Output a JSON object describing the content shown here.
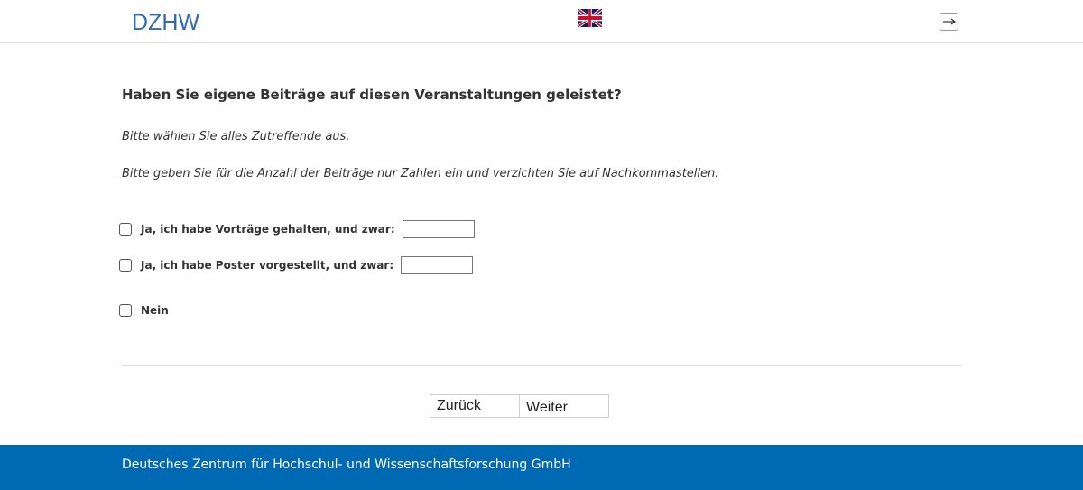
{
  "header": {
    "logo": "DZHW",
    "language_icon": "uk-flag-icon",
    "logout_icon": "logout-icon"
  },
  "question": {
    "title": "Haben Sie eigene Beiträge auf diesen Veranstaltungen geleistet?",
    "instruction_1": "Bitte wählen Sie alles Zutreffende aus.",
    "instruction_2": "Bitte geben Sie für die Anzahl der Beiträge nur Zahlen ein und verzichten Sie auf Nachkommastellen."
  },
  "options": [
    {
      "label": "Ja, ich habe Vorträge gehalten, und zwar:",
      "checked": false,
      "value": ""
    },
    {
      "label": "Ja, ich habe Poster vorgestellt, und zwar:",
      "checked": false,
      "value": ""
    },
    {
      "label": "Nein",
      "checked": false
    }
  ],
  "navigation": {
    "back_label": "Zurück",
    "next_label": "Weiter"
  },
  "footer": {
    "text": "Deutsches Zentrum für Hochschul- und Wissenschaftsforschung GmbH"
  },
  "colors": {
    "brand_blue": "#2f6bb3",
    "footer_bg": "#0069b4"
  }
}
